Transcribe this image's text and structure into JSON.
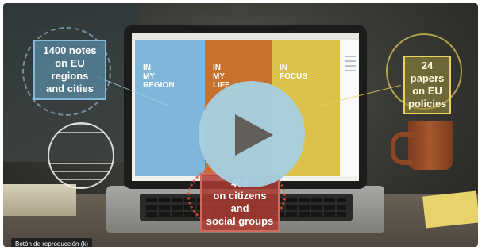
{
  "video": {
    "panels": [
      {
        "label": "IN\nMY\nREGION",
        "color": "#7fb6d9"
      },
      {
        "label": "IN\nMY\nLIFE",
        "color": "#c7712f"
      },
      {
        "label": "IN\nFOCUS",
        "color": "#dcc24a"
      }
    ],
    "callouts": {
      "notes": "1400 notes\non EU regions\nand cities",
      "papers": "24 papers\non EU\npolicies",
      "social": "400\non citizens and\nsocial groups"
    },
    "play_button": {
      "icon": "play-icon",
      "color": "#a6d0e2"
    },
    "tooltip": "Botón de reproducción (k)"
  }
}
